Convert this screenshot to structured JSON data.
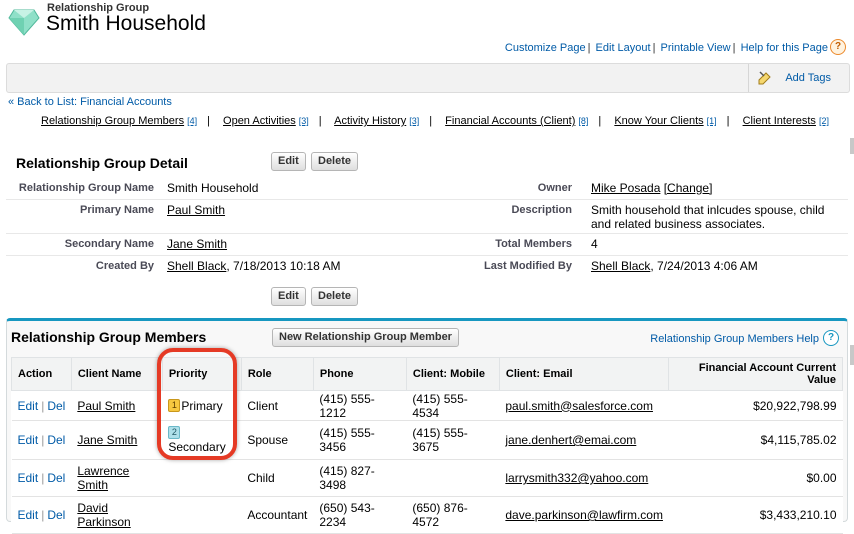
{
  "header": {
    "object_type": "Relationship Group",
    "title": "Smith Household",
    "links": [
      "Customize Page",
      "Edit Layout",
      "Printable View",
      "Help for this Page"
    ],
    "help_glyph": "?"
  },
  "tagbar": {
    "add_tags": "Add Tags"
  },
  "back_link": "« Back to List: Financial Accounts",
  "related_links": [
    {
      "label": "Relationship Group Members",
      "count": "[4]"
    },
    {
      "label": "Open Activities",
      "count": "[3]"
    },
    {
      "label": "Activity History",
      "count": "[3]"
    },
    {
      "label": "Financial Accounts (Client)",
      "count": "[8]"
    },
    {
      "label": "Know Your Clients",
      "count": "[1]"
    },
    {
      "label": "Client Interests",
      "count": "[2]"
    }
  ],
  "related_sep": "|",
  "detail": {
    "title": "Relationship Group Detail",
    "edit": "Edit",
    "delete": "Delete",
    "fields": {
      "group_name_label": "Relationship Group Name",
      "group_name": "Smith Household",
      "owner_label": "Owner",
      "owner": "Mike Posada",
      "owner_change": "[Change]",
      "primary_label": "Primary Name",
      "primary": "Paul Smith",
      "description_label": "Description",
      "description_line1": "Smith household that inlcudes spouse, child",
      "description_line2": "and related business associates.",
      "secondary_label": "Secondary Name",
      "secondary": "Jane Smith",
      "total_label": "Total Members",
      "total": "4",
      "created_label": "Created By",
      "created_by": "Shell Black",
      "created_date": ", 7/18/2013 10:18 AM",
      "modified_label": "Last Modified By",
      "modified_by": "Shell Black",
      "modified_date": ", 7/24/2013 4:06 AM"
    }
  },
  "members": {
    "title": "Relationship Group Members",
    "new_button": "New Relationship Group Member",
    "help_link": "Relationship Group Members Help",
    "help_glyph": "?",
    "columns": [
      "Action",
      "Client Name",
      "Priority",
      "Role",
      "Phone",
      "Client: Mobile",
      "Client: Email",
      "Financial Account Current Value"
    ],
    "edit": "Edit",
    "del": "Del",
    "action_sep": "|",
    "rows": [
      {
        "name1": "Paul Smith",
        "name2": "",
        "badge": "1",
        "badge_color": "#f6c740",
        "priority": "Primary",
        "role": "Client",
        "phone": "(415) 555-1212",
        "mobile": "(415) 555-4534",
        "email": "paul.smith@salesforce.com",
        "value": "$20,922,798.99"
      },
      {
        "name1": "Jane Smith",
        "name2": "",
        "badge": "2",
        "badge_color": "#aee0ea",
        "priority": "Secondary",
        "role": "Spouse",
        "phone": "(415) 555-3456",
        "mobile": "(415) 555-3675",
        "email": "jane.denhert@emai.com",
        "value": "$4,115,785.02"
      },
      {
        "name1": "Lawrence",
        "name2": "Smith",
        "badge": "",
        "badge_color": "",
        "priority": "",
        "role": "Child",
        "phone": "(415) 827-3498",
        "mobile": "",
        "email": "larrysmith332@yahoo.com",
        "value": "$0.00"
      },
      {
        "name1": "David",
        "name2": "Parkinson",
        "badge": "",
        "badge_color": "",
        "priority": "",
        "role": "Accountant",
        "phone": "(650) 543-2234",
        "mobile": "(650) 876-4572",
        "email": "dave.parkinson@lawfirm.com",
        "value": "$3,433,210.10"
      }
    ]
  },
  "colors": {
    "link": "#015ba7",
    "section_accent": "#1797c0",
    "highlight": "#e53a25"
  }
}
